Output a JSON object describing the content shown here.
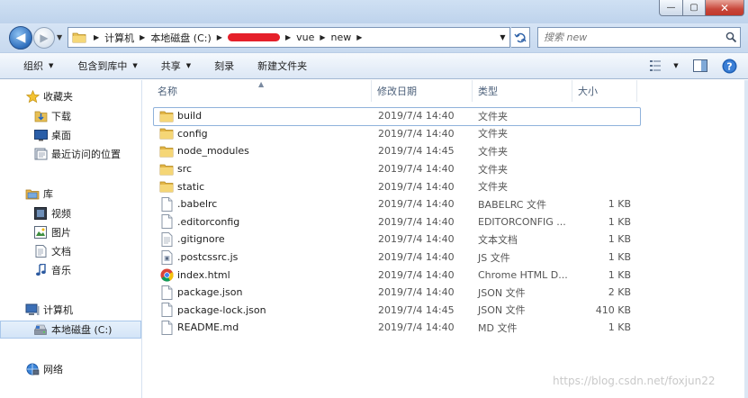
{
  "window": {
    "controls": {
      "minimize": "—",
      "maximize": "▢",
      "close": "✕"
    }
  },
  "address": {
    "crumbs": [
      "计算机",
      "本地磁盘 (C:)",
      "vue",
      "new"
    ],
    "refresh_icon": "refresh-icon"
  },
  "search": {
    "placeholder": "搜索 new"
  },
  "toolbar": {
    "organize": "组织",
    "include_in_library": "包含到库中",
    "share": "共享",
    "burn": "刻录",
    "new_folder": "新建文件夹"
  },
  "nav": {
    "favorites": "收藏夹",
    "downloads": "下载",
    "desktop": "桌面",
    "recent": "最近访问的位置",
    "libraries": "库",
    "videos": "视频",
    "pictures": "图片",
    "documents": "文档",
    "music": "音乐",
    "computer": "计算机",
    "local_disk": "本地磁盘 (C:)",
    "network": "网络"
  },
  "columns": {
    "name": "名称",
    "date": "修改日期",
    "type": "类型",
    "size": "大小"
  },
  "files": [
    {
      "name": "build",
      "date": "2019/7/4 14:40",
      "type": "文件夹",
      "size": "",
      "icon": "folder"
    },
    {
      "name": "config",
      "date": "2019/7/4 14:40",
      "type": "文件夹",
      "size": "",
      "icon": "folder"
    },
    {
      "name": "node_modules",
      "date": "2019/7/4 14:45",
      "type": "文件夹",
      "size": "",
      "icon": "folder"
    },
    {
      "name": "src",
      "date": "2019/7/4 14:40",
      "type": "文件夹",
      "size": "",
      "icon": "folder"
    },
    {
      "name": "static",
      "date": "2019/7/4 14:40",
      "type": "文件夹",
      "size": "",
      "icon": "folder"
    },
    {
      "name": ".babelrc",
      "date": "2019/7/4 14:40",
      "type": "BABELRC 文件",
      "size": "1 KB",
      "icon": "file"
    },
    {
      "name": ".editorconfig",
      "date": "2019/7/4 14:40",
      "type": "EDITORCONFIG ...",
      "size": "1 KB",
      "icon": "file"
    },
    {
      "name": ".gitignore",
      "date": "2019/7/4 14:40",
      "type": "文本文档",
      "size": "1 KB",
      "icon": "textfile"
    },
    {
      "name": ".postcssrc.js",
      "date": "2019/7/4 14:40",
      "type": "JS 文件",
      "size": "1 KB",
      "icon": "jsfile"
    },
    {
      "name": "index.html",
      "date": "2019/7/4 14:40",
      "type": "Chrome HTML D...",
      "size": "1 KB",
      "icon": "chrome"
    },
    {
      "name": "package.json",
      "date": "2019/7/4 14:40",
      "type": "JSON 文件",
      "size": "2 KB",
      "icon": "file"
    },
    {
      "name": "package-lock.json",
      "date": "2019/7/4 14:45",
      "type": "JSON 文件",
      "size": "410 KB",
      "icon": "file"
    },
    {
      "name": "README.md",
      "date": "2019/7/4 14:40",
      "type": "MD 文件",
      "size": "1 KB",
      "icon": "file"
    }
  ],
  "watermark": "https://blog.csdn.net/foxjun22"
}
